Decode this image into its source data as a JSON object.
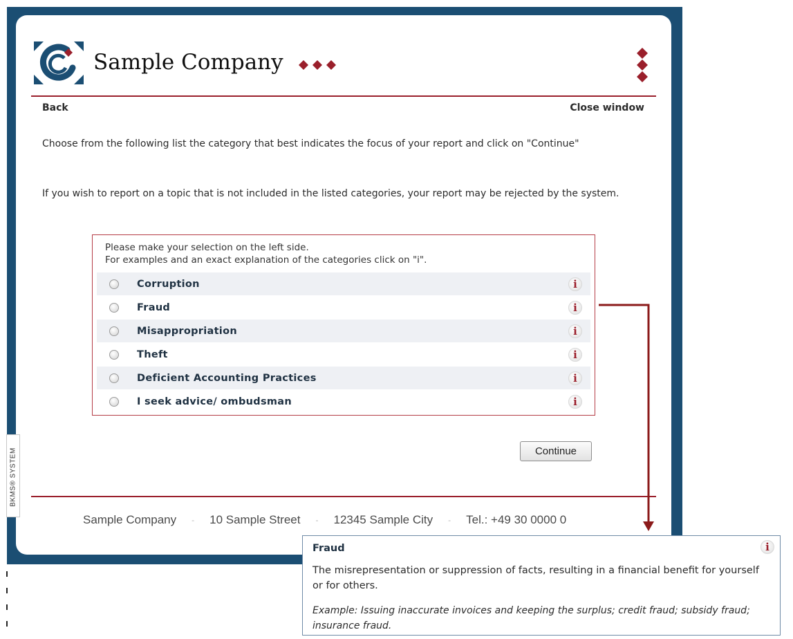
{
  "header": {
    "company_name": "Sample Company",
    "back_label": "Back",
    "close_label": "Close window"
  },
  "intro": {
    "instruction": "Choose from the following list the category that best indicates the focus of your report and click on \"Continue\"",
    "warning": "If you wish to report on a topic that is not included in the listed categories, your report may be rejected by the system."
  },
  "selection": {
    "hint_line1": "Please make your selection on the left side.",
    "hint_line2": "For examples and an exact explanation of the categories click on \"i\".",
    "info_glyph": "i",
    "options": [
      {
        "label": "Corruption"
      },
      {
        "label": "Fraud"
      },
      {
        "label": "Misappropriation"
      },
      {
        "label": "Theft"
      },
      {
        "label": "Deficient Accounting Practices"
      },
      {
        "label": "I seek advice/ ombudsman"
      }
    ]
  },
  "continue_label": "Continue",
  "system_label": "BKMS® SYSTEM",
  "footer": {
    "company": "Sample Company",
    "street": "10 Sample Street",
    "city": "12345 Sample City",
    "phone": "Tel.: +49 30 0000 0",
    "separator": "-"
  },
  "tooltip": {
    "title": "Fraud",
    "description": "The misrepresentation or suppression of facts, resulting in a financial benefit for yourself or for others.",
    "example": "Example: Issuing inaccurate invoices and keeping the surplus; credit fraud; subsidy fraud; insurance fraud."
  },
  "colors": {
    "frame": "#1b4e73",
    "accent_red": "#9a1f2b",
    "label_navy": "#1f3142"
  },
  "icons": {
    "logo": "company-logo",
    "brand_dots": "diamond-dots-icon",
    "side_dots": "diamond-dots-icon",
    "radio": "radio-icon",
    "info": "info-icon",
    "arrow": "callout-arrow-icon"
  }
}
